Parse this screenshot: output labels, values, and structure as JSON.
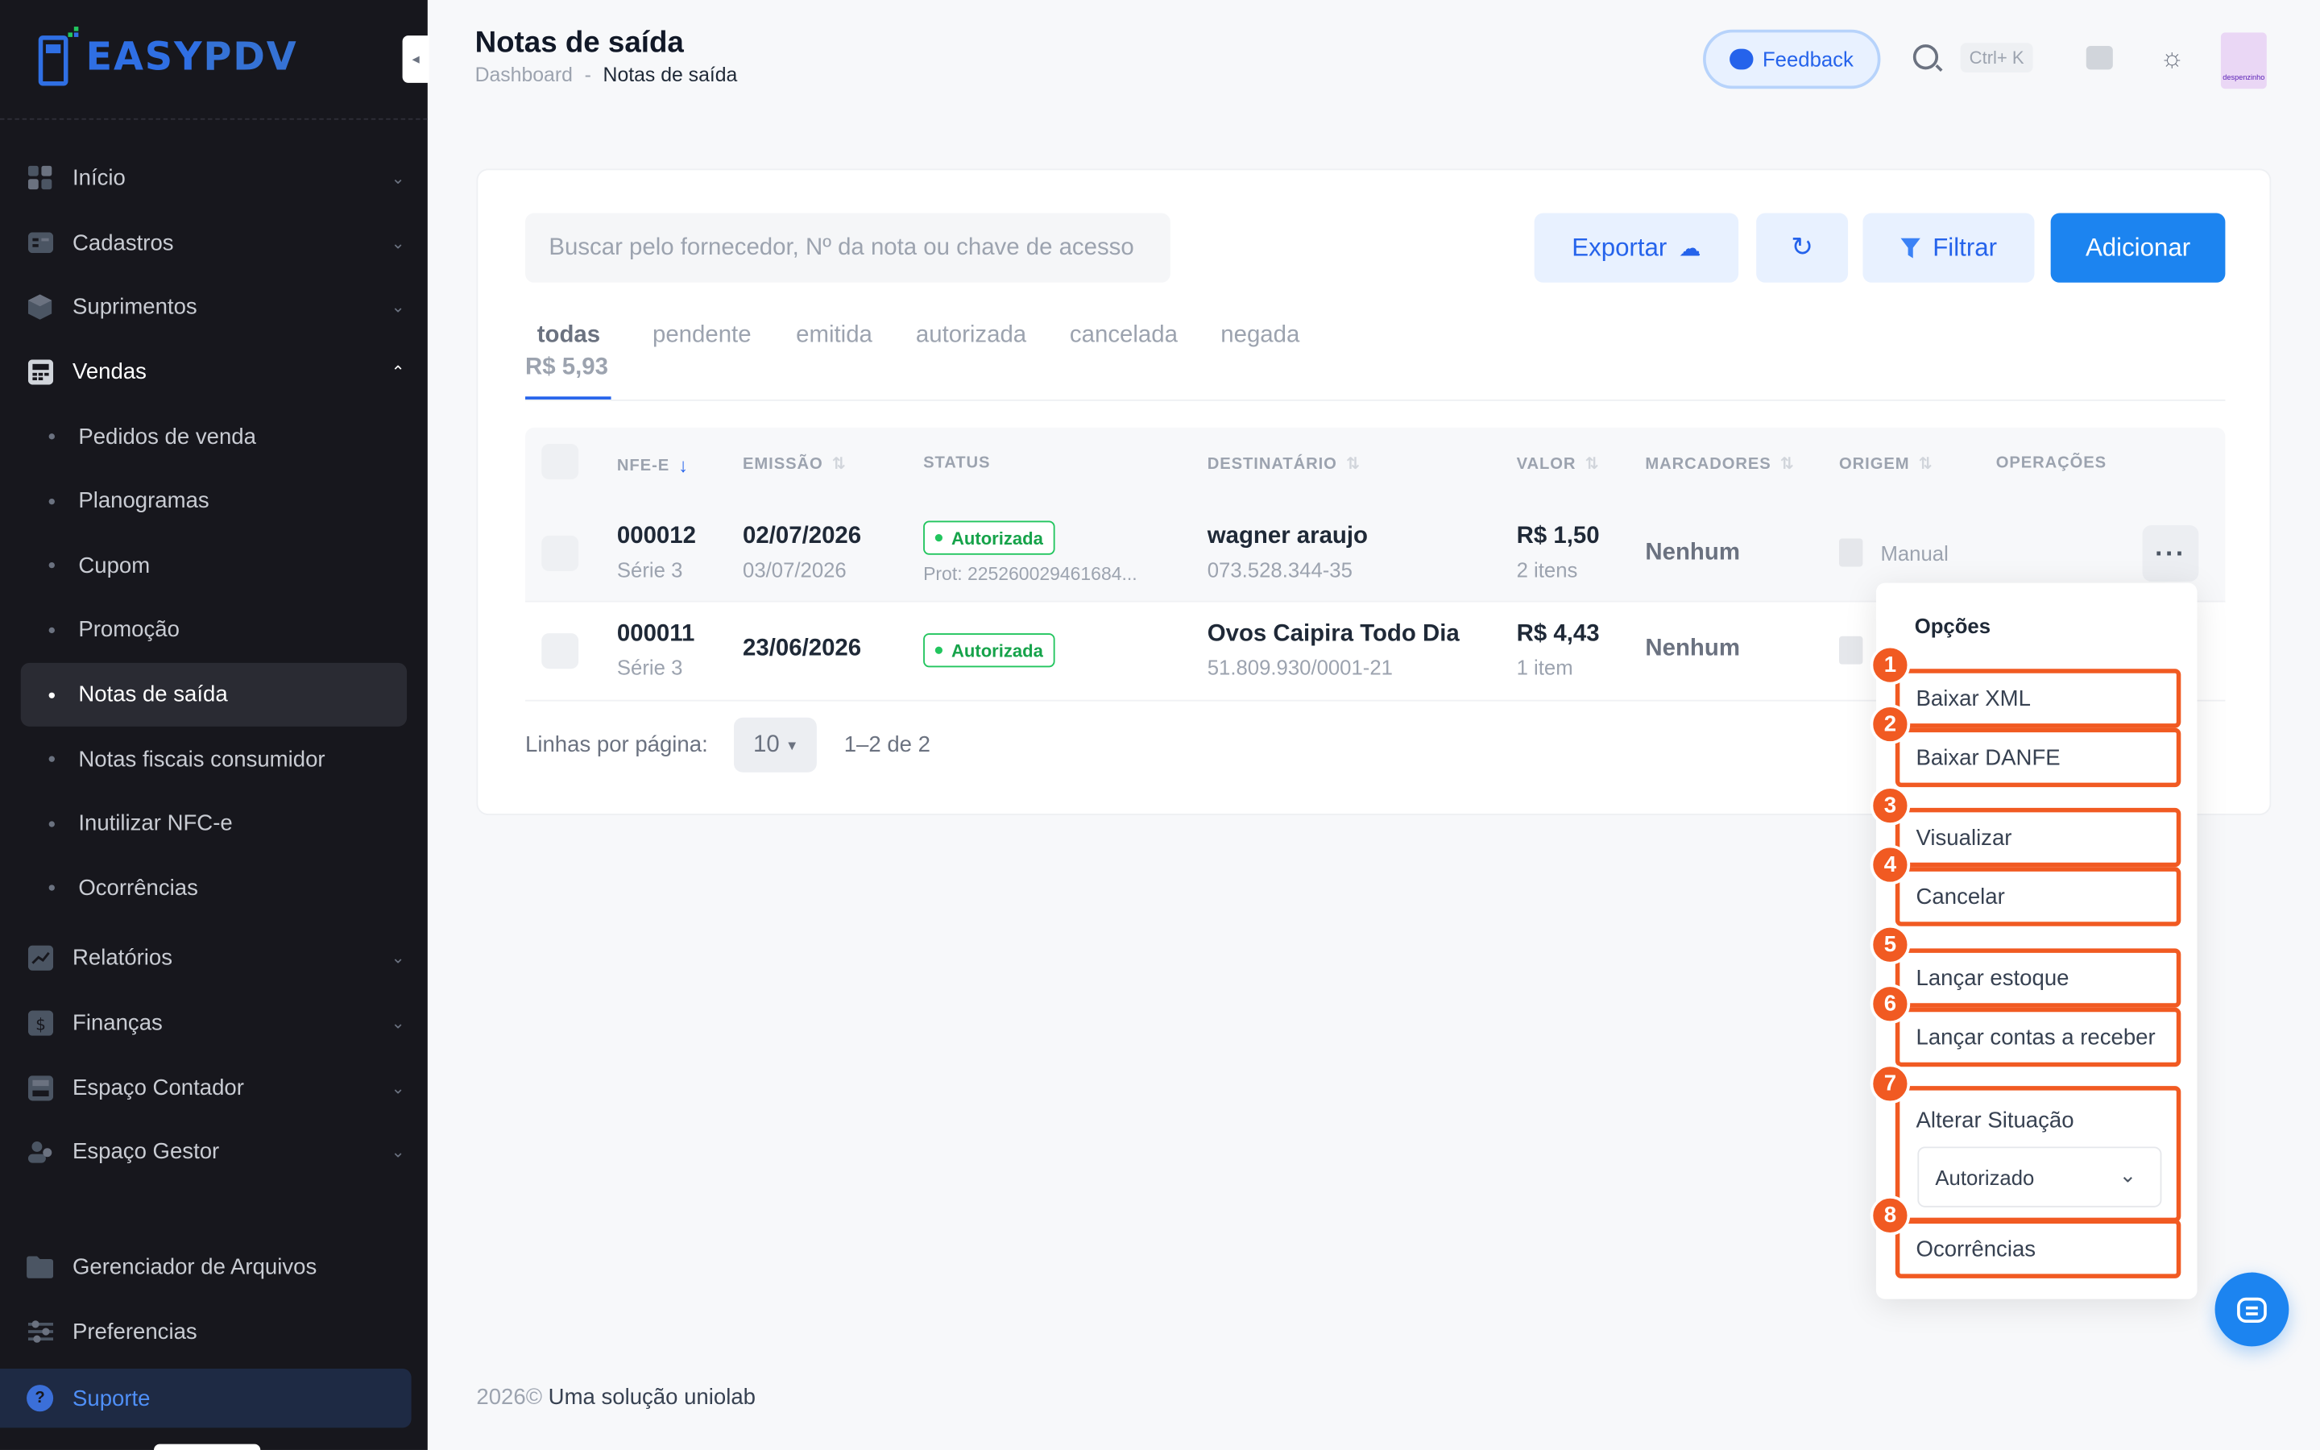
{
  "brand": {
    "logo_text_a": "EASY",
    "logo_text_b": "PDV"
  },
  "sidebar": {
    "items": [
      {
        "label": "Início",
        "icon": "grid-icon"
      },
      {
        "label": "Cadastros",
        "icon": "id-card-icon"
      },
      {
        "label": "Suprimentos",
        "icon": "box-icon"
      },
      {
        "label": "Vendas",
        "icon": "register-icon"
      }
    ],
    "vendas_sub": [
      {
        "label": "Pedidos de venda"
      },
      {
        "label": "Planogramas"
      },
      {
        "label": "Cupom"
      },
      {
        "label": "Promoção"
      },
      {
        "label": "Notas de saída"
      },
      {
        "label": "Notas fiscais consumidor"
      },
      {
        "label": "Inutilizar NFC-e"
      },
      {
        "label": "Ocorrências"
      }
    ],
    "items_after": [
      {
        "label": "Relatórios",
        "icon": "chart-icon"
      },
      {
        "label": "Finanças",
        "icon": "dollar-icon"
      },
      {
        "label": "Espaço Contador",
        "icon": "calculator-icon"
      },
      {
        "label": "Espaço Gestor",
        "icon": "manager-icon"
      }
    ],
    "bottom": [
      {
        "label": "Gerenciador de Arquivos",
        "icon": "folder-icon"
      },
      {
        "label": "Preferencias",
        "icon": "sliders-icon"
      }
    ],
    "support": "Suporte"
  },
  "header": {
    "title": "Notas de saída",
    "breadcrumb_root": "Dashboard",
    "breadcrumb_sep": "-",
    "breadcrumb_current": "Notas de saída",
    "feedback": "Feedback",
    "shortcut": "Ctrl+ K",
    "avatar_text": "despenzinho"
  },
  "toolbar": {
    "search_placeholder": "Buscar pelo fornecedor, Nº da nota ou chave de acesso",
    "export": "Exportar",
    "filter": "Filtrar",
    "add": "Adicionar"
  },
  "tabs": {
    "items": [
      "todas",
      "pendente",
      "emitida",
      "autorizada",
      "cancelada",
      "negada"
    ],
    "active": "todas",
    "sum": "R$ 5,93"
  },
  "table": {
    "headers": [
      "NFE-E",
      "EMISSÃO",
      "STATUS",
      "DESTINATÁRIO",
      "VALOR",
      "MARCADORES",
      "ORIGEM",
      "OPERAÇÕES"
    ],
    "rows": [
      {
        "number": "000012",
        "serie": "Série 3",
        "date": "02/07/2026",
        "date2": "03/07/2026",
        "status": "Autorizada",
        "prot": "Prot: 225260029461684...",
        "dest": "wagner araujo",
        "doc": "073.528.344-35",
        "valor": "R$ 1,50",
        "itens": "2 itens",
        "marcadores": "Nenhum",
        "origem": "Manual"
      },
      {
        "number": "000011",
        "serie": "Série 3",
        "date": "23/06/2026",
        "date2": "",
        "status": "Autorizada",
        "prot": "",
        "dest": "Ovos Caipira Todo Dia",
        "doc": "51.809.930/0001-21",
        "valor": "R$ 4,43",
        "itens": "1 item",
        "marcadores": "Nenhum",
        "origem": ""
      }
    ]
  },
  "pager": {
    "label": "Linhas por página:",
    "value": "10",
    "range": "1–2 de 2"
  },
  "menu": {
    "title": "Opções",
    "items": [
      {
        "n": "1",
        "label": "Baixar XML"
      },
      {
        "n": "2",
        "label": "Baixar DANFE"
      },
      {
        "n": "3",
        "label": "Visualizar"
      },
      {
        "n": "4",
        "label": "Cancelar"
      },
      {
        "n": "5",
        "label": "Lançar estoque"
      },
      {
        "n": "6",
        "label": "Lançar contas a receber"
      },
      {
        "n": "7",
        "label": "Alterar Situação"
      },
      {
        "n": "8",
        "label": "Ocorrências"
      }
    ],
    "situation_value": "Autorizado"
  },
  "footer": {
    "year": "2026©",
    "text": "Uma solução uniolab"
  },
  "colors": {
    "accent": "#1c84f0",
    "highlight": "#f15a22",
    "success": "#22c55e",
    "sidebar_bg": "#17171d"
  }
}
